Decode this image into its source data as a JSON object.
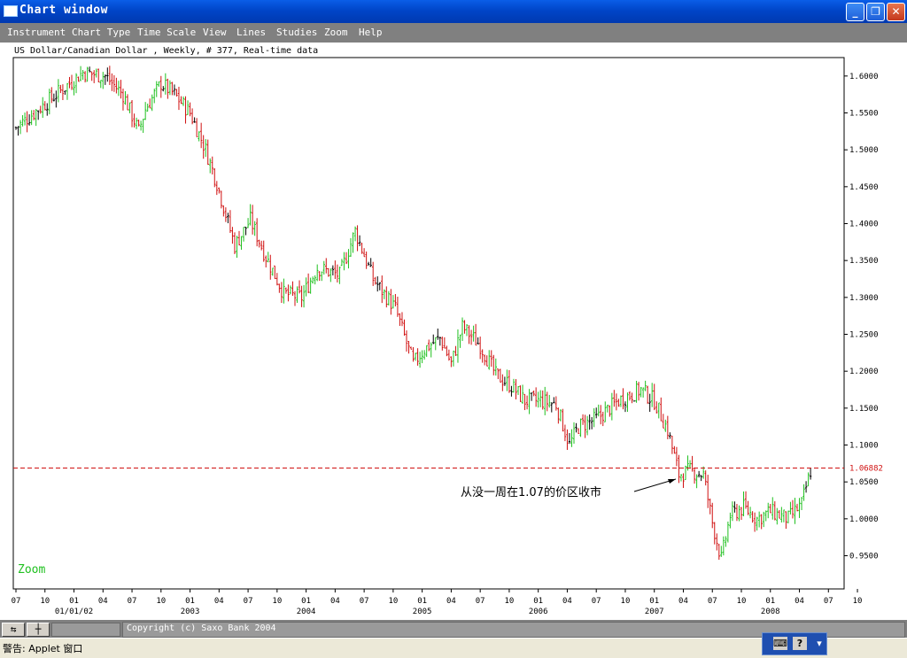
{
  "window": {
    "title": "Chart window"
  },
  "menu": [
    "Instrument",
    "Chart Type",
    "Time Scale",
    "View",
    "Lines",
    "Studies",
    "Zoom",
    "Help"
  ],
  "chart_title": "US Dollar/Canadian Dollar , Weekly, # 377, Real-time data",
  "zoom_label": "Zoom",
  "annotation": "从没一周在1.07的价区收市",
  "colors": {
    "bull": "#1fc01f",
    "bear": "#d01010",
    "neutral": "#000000",
    "ref_line": "#d01010",
    "zoom": "#1fc01f"
  },
  "chart_data": {
    "type": "ohlc",
    "title": "US Dollar/Canadian Dollar , Weekly, # 377, Real-time data",
    "ylim": [
      0.905,
      1.625
    ],
    "y_ticks": [
      "1.6000",
      "1.5500",
      "1.5000",
      "1.4500",
      "1.4000",
      "1.3500",
      "1.3000",
      "1.2500",
      "1.2000",
      "1.1500",
      "1.1000",
      "1.0500",
      "1.0000",
      "0.9500"
    ],
    "reference_line": {
      "value": 1.06882,
      "label": "1.06882",
      "style": "dashed"
    },
    "x_month_ticks": [
      "07",
      "10",
      "01",
      "04",
      "07",
      "10",
      "01",
      "04",
      "07",
      "10",
      "01",
      "04",
      "07",
      "10",
      "01",
      "04",
      "07",
      "10",
      "01",
      "04",
      "07",
      "10",
      "01",
      "04",
      "07",
      "10",
      "01",
      "04",
      "07",
      "10"
    ],
    "x_year_labels": [
      "01/01/02",
      "2003",
      "2004",
      "2005",
      "2006",
      "2007",
      "2008"
    ],
    "bars_per_quarter": 13,
    "weekly_close_path": [
      [
        0,
        1.53
      ],
      [
        10,
        1.555
      ],
      [
        20,
        1.58
      ],
      [
        30,
        1.605
      ],
      [
        40,
        1.6
      ],
      [
        48,
        1.575
      ],
      [
        55,
        1.525
      ],
      [
        58,
        1.555
      ],
      [
        65,
        1.59
      ],
      [
        71,
        1.575
      ],
      [
        78,
        1.55
      ],
      [
        85,
        1.5
      ],
      [
        90,
        1.455
      ],
      [
        98,
        1.37
      ],
      [
        105,
        1.405
      ],
      [
        112,
        1.355
      ],
      [
        120,
        1.305
      ],
      [
        128,
        1.3
      ],
      [
        135,
        1.34
      ],
      [
        145,
        1.33
      ],
      [
        152,
        1.39
      ],
      [
        160,
        1.325
      ],
      [
        170,
        1.285
      ],
      [
        178,
        1.21
      ],
      [
        183,
        1.23
      ],
      [
        190,
        1.245
      ],
      [
        195,
        1.21
      ],
      [
        200,
        1.26
      ],
      [
        208,
        1.235
      ],
      [
        215,
        1.195
      ],
      [
        222,
        1.18
      ],
      [
        228,
        1.16
      ],
      [
        235,
        1.16
      ],
      [
        242,
        1.155
      ],
      [
        248,
        1.1
      ],
      [
        252,
        1.125
      ],
      [
        260,
        1.135
      ],
      [
        270,
        1.16
      ],
      [
        280,
        1.175
      ],
      [
        286,
        1.16
      ],
      [
        292,
        1.12
      ],
      [
        297,
        1.06
      ],
      [
        302,
        1.065
      ],
      [
        308,
        1.06
      ],
      [
        312,
        0.995
      ],
      [
        316,
        0.945
      ],
      [
        320,
        1.005
      ],
      [
        326,
        1.015
      ],
      [
        332,
        1.0
      ],
      [
        338,
        1.01
      ],
      [
        346,
        1.0
      ],
      [
        352,
        1.02
      ],
      [
        356,
        1.065
      ]
    ]
  },
  "footer": {
    "copyright": "Copyright (c) Saxo Bank 2004"
  },
  "status": {
    "text": "警告: Applet 窗口"
  }
}
